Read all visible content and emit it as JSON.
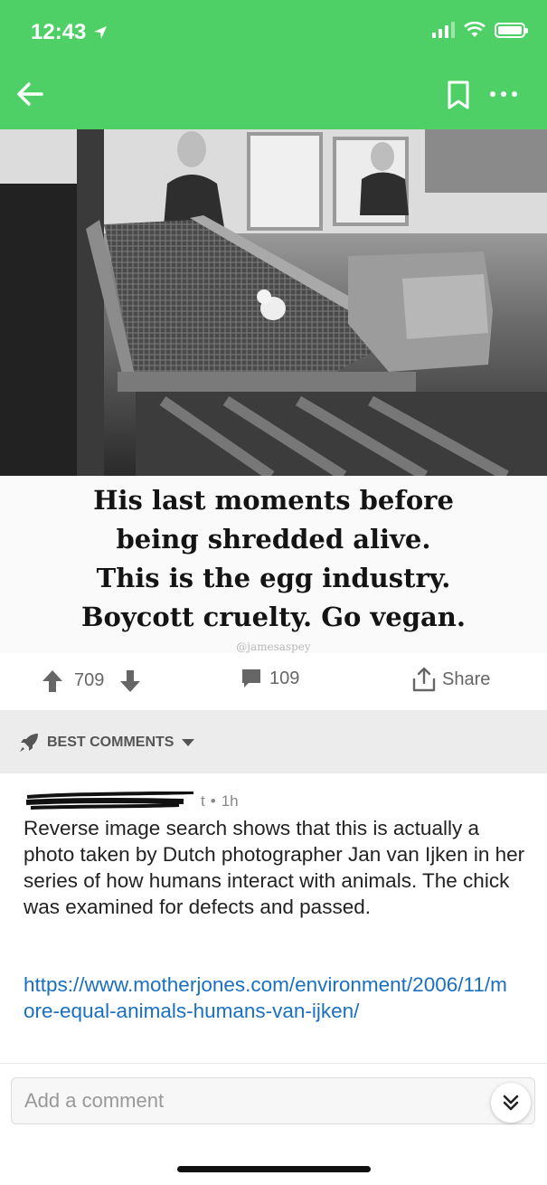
{
  "status_bar": {
    "time": "12:43"
  },
  "post": {
    "meme_lines": [
      "His last moments before",
      "being shredded alive.",
      "This is the egg industry.",
      "Boycott cruelty. Go vegan."
    ],
    "watermark": "@jamesaspey",
    "upvotes": "709",
    "comments": "109",
    "share_label": "Share"
  },
  "sort": {
    "label": "BEST COMMENTS"
  },
  "comment": {
    "author_fragment": "t",
    "age": "1h",
    "body": "Reverse image search shows that this is actually a photo taken by Dutch photographer Jan van Ijken in her series of how humans interact with animals. The chick was examined for defects and passed.",
    "link": "https://www.motherjones.com/environment/2006/11/more-equal-animals-humans-van-ijken/"
  },
  "composer": {
    "placeholder": "Add a comment"
  },
  "colors": {
    "accent": "#4fd067",
    "link": "#1a6fc2"
  }
}
